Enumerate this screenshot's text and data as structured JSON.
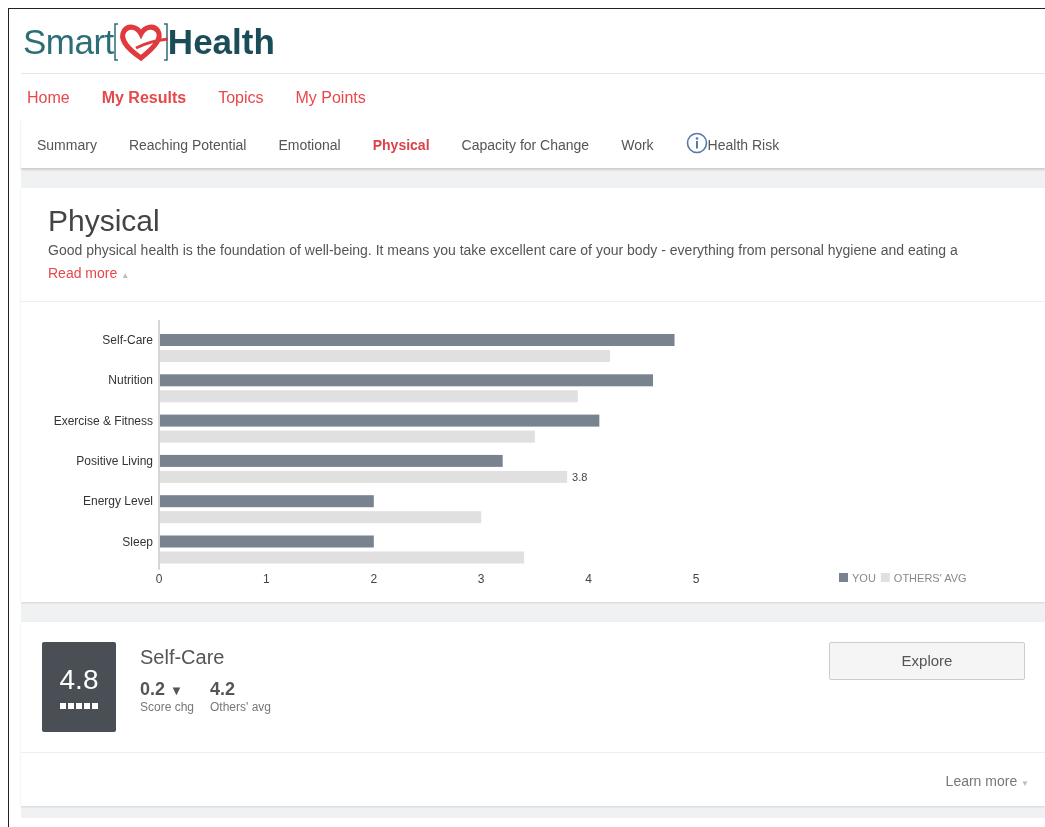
{
  "logo": {
    "part_1": "Smart",
    "part_2": "Health"
  },
  "main_nav": [
    {
      "label": "Home",
      "selected": false
    },
    {
      "label": "My Results",
      "selected": true
    },
    {
      "label": "Topics",
      "selected": false
    },
    {
      "label": "My Points",
      "selected": false
    }
  ],
  "sub_tabs": [
    {
      "label": "Summary",
      "selected": false
    },
    {
      "label": "Reaching Potential",
      "selected": false
    },
    {
      "label": "Emotional",
      "selected": false
    },
    {
      "label": "Physical",
      "selected": true
    },
    {
      "label": "Capacity for Change",
      "selected": false
    },
    {
      "label": "Work",
      "selected": false
    },
    {
      "label": "Health Risk",
      "selected": false,
      "kind": "info"
    }
  ],
  "section": {
    "title": "Physical",
    "description": "Good physical health is the foundation of well-being. It means you take excellent care of your body - everything from personal hygiene and eating a",
    "read_more": "Read more",
    "read_more_caret": "▲",
    "chart_data": {
      "type": "bar",
      "orientation": "horizontal",
      "categories": [
        "Self-Care",
        "Nutrition",
        "Exercise & Fitness",
        "Positive Living",
        "Energy Level",
        "Sleep"
      ],
      "series": [
        {
          "name": "YOU",
          "color": "#78838f",
          "values": [
            4.8,
            4.6,
            4.1,
            3.2,
            2.0,
            2.0
          ]
        },
        {
          "name": "OTHERS' AVG",
          "color": "#e0e0e0",
          "values": [
            4.2,
            3.9,
            3.5,
            3.8,
            3.0,
            3.4
          ]
        }
      ],
      "xlim": [
        0,
        5
      ],
      "xticks": [
        0,
        1,
        2,
        3,
        4,
        5
      ],
      "legend": "bottom-right",
      "annotations": [
        {
          "text": "3.8",
          "x": 3.8,
          "y": "Positive Living"
        }
      ]
    }
  },
  "score_card": {
    "score": "4.8",
    "title": "Self-Care",
    "change": "0.2",
    "change_arrow": "▼",
    "change_label": "Score chg",
    "others_avg": "4.2",
    "others_label": "Others' avg",
    "button": "Explore",
    "learn_more": "Learn more",
    "learn_more_caret": "▼"
  }
}
